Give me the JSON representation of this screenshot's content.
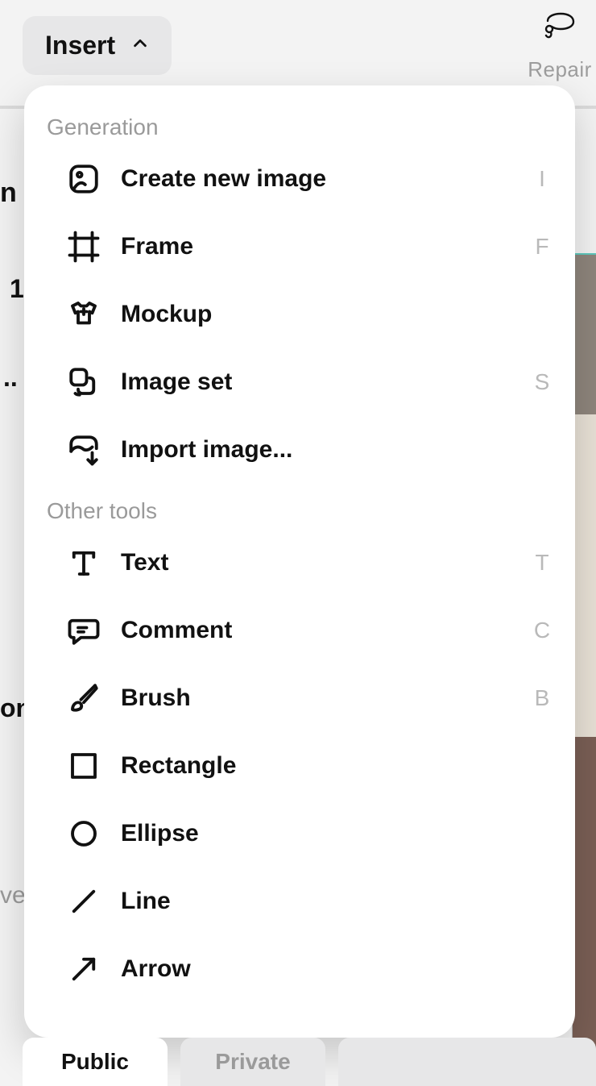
{
  "topbar": {
    "insert_label": "Insert",
    "repair_label": "Repair"
  },
  "background": {
    "n_label": "n",
    "one_label": "1",
    "ellipsis": "..",
    "on_label": "on",
    "vel_label": "vel"
  },
  "menu": {
    "sections": [
      {
        "title": "Generation",
        "items": [
          {
            "id": "create-new-image",
            "label": "Create new image",
            "shortcut": "I",
            "icon": "image-icon"
          },
          {
            "id": "frame",
            "label": "Frame",
            "shortcut": "F",
            "icon": "frame-icon"
          },
          {
            "id": "mockup",
            "label": "Mockup",
            "shortcut": "",
            "icon": "mockup-icon"
          },
          {
            "id": "image-set",
            "label": "Image set",
            "shortcut": "S",
            "icon": "image-set-icon"
          },
          {
            "id": "import-image",
            "label": "Import image...",
            "shortcut": "",
            "icon": "import-icon"
          }
        ]
      },
      {
        "title": "Other tools",
        "items": [
          {
            "id": "text",
            "label": "Text",
            "shortcut": "T",
            "icon": "text-icon"
          },
          {
            "id": "comment",
            "label": "Comment",
            "shortcut": "C",
            "icon": "comment-icon"
          },
          {
            "id": "brush",
            "label": "Brush",
            "shortcut": "B",
            "icon": "brush-icon"
          },
          {
            "id": "rectangle",
            "label": "Rectangle",
            "shortcut": "",
            "icon": "rectangle-icon"
          },
          {
            "id": "ellipse",
            "label": "Ellipse",
            "shortcut": "",
            "icon": "ellipse-icon"
          },
          {
            "id": "line",
            "label": "Line",
            "shortcut": "",
            "icon": "line-icon"
          },
          {
            "id": "arrow",
            "label": "Arrow",
            "shortcut": "",
            "icon": "arrow-icon"
          }
        ]
      }
    ]
  },
  "bottom_tabs": {
    "public": "Public",
    "private": "Private"
  }
}
